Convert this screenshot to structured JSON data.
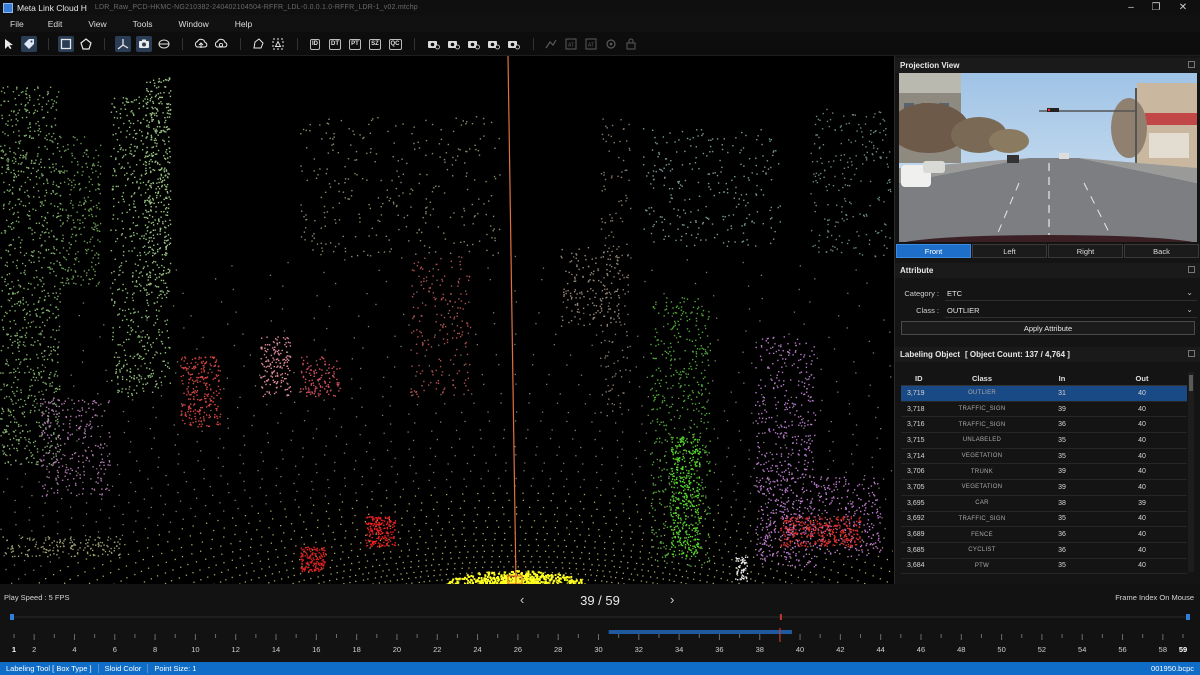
{
  "window": {
    "app_title": "Meta Link Cloud H",
    "file_path": "LDR_Raw_PCD-HKMC-NG210382-240402104504-RFFR_LDL-0.0.0.1.0-RFFR_LDR-1_v02.mtchp",
    "controls": [
      "minimize",
      "maximize",
      "close"
    ]
  },
  "menu": [
    "File",
    "Edit",
    "View",
    "Tools",
    "Window",
    "Help"
  ],
  "toolbar": {
    "text_buttons": [
      "ID",
      "DT",
      "PT",
      "SZ",
      "QC"
    ]
  },
  "projection_view": {
    "title": "Projection View",
    "tabs": [
      "Front",
      "Left",
      "Right",
      "Back"
    ],
    "selected_tab": "Front"
  },
  "attribute": {
    "title": "Attribute",
    "category_label": "Category :",
    "category_value": "ETC",
    "class_label": "Class :",
    "class_value": "OUTLIER",
    "apply_button": "Apply Attribute"
  },
  "labeling_object": {
    "title": "Labeling Object",
    "count_text": "[ Object Count: 137 / 4,764 ]",
    "columns": [
      "ID",
      "Class",
      "In",
      "Out"
    ],
    "selected_index": 0,
    "rows": [
      {
        "id": "3,719",
        "class": "OUTLIER",
        "in": "31",
        "out": "40"
      },
      {
        "id": "3,718",
        "class": "TRAFFIC_SIGN",
        "in": "39",
        "out": "40"
      },
      {
        "id": "3,716",
        "class": "TRAFFIC_SIGN",
        "in": "36",
        "out": "40"
      },
      {
        "id": "3,715",
        "class": "UNLABELED",
        "in": "35",
        "out": "40"
      },
      {
        "id": "3,714",
        "class": "VEGETATION",
        "in": "35",
        "out": "40"
      },
      {
        "id": "3,706",
        "class": "TRUNK",
        "in": "39",
        "out": "40"
      },
      {
        "id": "3,705",
        "class": "VEGETATION",
        "in": "39",
        "out": "40"
      },
      {
        "id": "3,695",
        "class": "CAR",
        "in": "38",
        "out": "39"
      },
      {
        "id": "3,692",
        "class": "TRAFFIC_SIGN",
        "in": "35",
        "out": "40"
      },
      {
        "id": "3,689",
        "class": "FENCE",
        "in": "36",
        "out": "40"
      },
      {
        "id": "3,685",
        "class": "CYCLIST",
        "in": "36",
        "out": "40"
      },
      {
        "id": "3,684",
        "class": "PTW",
        "in": "35",
        "out": "40"
      }
    ]
  },
  "timeline": {
    "play_speed": "Play Speed : 5 FPS",
    "frame_counter": "39 / 59",
    "prev_arrow": "‹",
    "next_arrow": "›",
    "frame_index_label": "Frame Index On Mouse",
    "current_frame": 39,
    "total_frames": 59,
    "range_start": 31,
    "range_end": 40,
    "tick_labels": [
      1,
      2,
      4,
      6,
      8,
      10,
      12,
      14,
      16,
      18,
      20,
      22,
      24,
      26,
      28,
      30,
      32,
      34,
      36,
      38,
      40,
      42,
      44,
      46,
      48,
      50,
      52,
      54,
      56,
      58,
      59
    ]
  },
  "statusbar": {
    "tool": "Labeling Tool [ Box Type ]",
    "color": "Sloid Color",
    "point_size": "Point Size: 1",
    "file": "001950.bcpc"
  },
  "colors": {
    "accent": "#1e6fc9",
    "selected_row": "#1a4a85",
    "statusbar": "#0f6cc7"
  }
}
